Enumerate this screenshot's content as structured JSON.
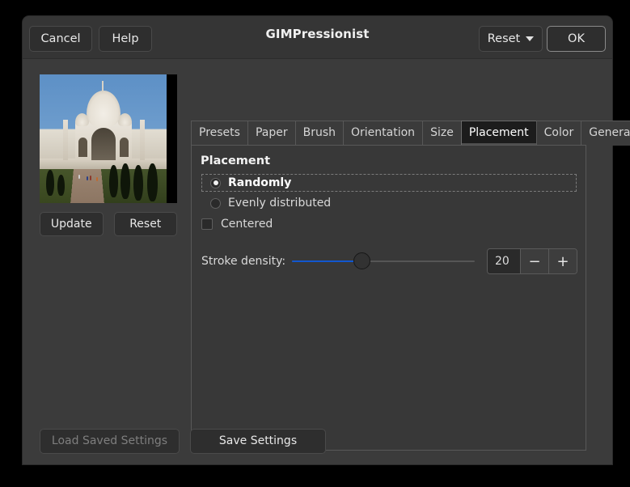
{
  "window": {
    "title": "GIMPressionist",
    "titlebar_buttons": {
      "cancel": "Cancel",
      "help": "Help",
      "reset": "Reset",
      "ok": "OK"
    }
  },
  "preview": {
    "alt": "taj-mahal-preview",
    "update_label": "Update",
    "reset_label": "Reset"
  },
  "notebook": {
    "tabs": [
      {
        "label": "Presets",
        "selected": false
      },
      {
        "label": "Paper",
        "selected": false
      },
      {
        "label": "Brush",
        "selected": false
      },
      {
        "label": "Orientation",
        "selected": false
      },
      {
        "label": "Size",
        "selected": false
      },
      {
        "label": "Placement",
        "selected": true
      },
      {
        "label": "Color",
        "selected": false
      },
      {
        "label": "General",
        "selected": false
      }
    ],
    "selected_tab": "Placement"
  },
  "placement": {
    "section_title": "Placement",
    "radios": [
      {
        "label": "Randomly",
        "selected": true,
        "focused": true
      },
      {
        "label": "Evenly distributed",
        "selected": false,
        "focused": false
      }
    ],
    "centered": {
      "label": "Centered",
      "checked": false
    },
    "stroke_density": {
      "label": "Stroke density:",
      "value": "20",
      "percent": 38,
      "minus_label": "−",
      "plus_label": "+"
    }
  },
  "footer": {
    "load_label": "Load Saved Settings",
    "load_enabled": false,
    "save_label": "Save Settings",
    "save_enabled": true
  },
  "colors": {
    "window_bg": "#3b3b3b",
    "panel_bg": "#383838",
    "titlebar_bg": "#353535",
    "button_bg": "#2e2e2e",
    "selected_tab_bg": "#1c1c1c",
    "accent_blue": "#1257cf",
    "text": "#e8e8e8",
    "text_disabled": "#7e7e7e"
  }
}
